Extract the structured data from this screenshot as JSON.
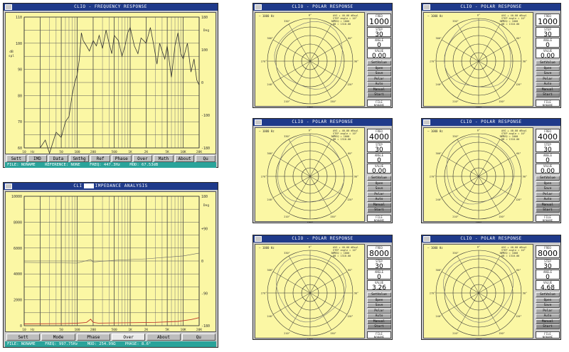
{
  "colors": {
    "title_bg": "#1f3a8a",
    "plot_bg": "#fbf7a4",
    "status_bg": "#2aa39a",
    "trace": "#333333",
    "impedance_trace": "#c0392b"
  },
  "freq_window": {
    "title": "CLIO - FREQUENCY RESPONSE",
    "y_left_unit": "dB\nspl",
    "y_right_unit": "Deg",
    "y_left_ticks": [
      "110",
      "100",
      "90",
      "80",
      "70",
      "60"
    ],
    "y_right_ticks": [
      "180",
      "100",
      "0",
      "-100",
      "-180"
    ],
    "x_ticks": [
      "10",
      "Hz",
      "50",
      "100",
      "200",
      "500",
      "1K",
      "2K",
      "5K",
      "10K",
      "20K"
    ],
    "buttons": [
      "Sett",
      "IMD",
      "Data",
      "Smthg",
      "Ref",
      "Phase",
      "Over",
      "Math",
      "About",
      "Qu"
    ],
    "status": {
      "file": "FILE: NONAME",
      "reference": "REFERENCE: NONE",
      "freq": "FREQ: 447.3Hz",
      "mod": "MOD: 67.53dB"
    }
  },
  "imp_window": {
    "title_prefix": "CLI",
    "title_suffix": "IMPEDANCE ANALYSIS",
    "y_left_ticks": [
      "10000",
      "8000",
      "6000",
      "4000",
      "2000",
      "0"
    ],
    "y_right_unit": "Deg",
    "y_right_ticks": [
      "180",
      "+90",
      "0",
      "-90",
      "-180"
    ],
    "x_ticks": [
      "10",
      "Hz",
      "50",
      "100",
      "200",
      "500",
      "1K",
      "2K",
      "5K",
      "10K",
      "20K"
    ],
    "buttons": [
      "Sett",
      "Mode",
      "Phase",
      "Over",
      "About",
      "Qu"
    ],
    "active_button": "Over",
    "status": {
      "file": "FILE: NONAME",
      "freq": "FREQ: 997.75Hz",
      "mod": "MOD: 254.99Ω",
      "phase": "PHASE: 8.6°"
    }
  },
  "polar_common": {
    "title": "CLIO - POLAR RESPONSE",
    "legend": "1000 Hz",
    "info": "AVG + 40.00 dBspl\nSTEP angle = 10°\nFREQ = 1000\nDB = 1310.00",
    "caption_freq": "FREQ",
    "caption_step": "STEP",
    "caption_angle": "ANGLE",
    "caption_value": "VALUE",
    "buttons": [
      "SetValue",
      "Open",
      "Save",
      "Polar",
      "Auto",
      "Manual",
      "Start"
    ],
    "file_caption": "FILE",
    "file_value": "NONAME",
    "angle_labels": [
      "0°",
      "30°",
      "60°",
      "90°",
      "120°",
      "150°",
      "180°",
      "210°",
      "240°",
      "270°",
      "300°",
      "330°"
    ]
  },
  "polars": [
    {
      "freq": "1000",
      "step": "30",
      "angle": "0",
      "value": "0.00"
    },
    {
      "freq": "1000",
      "step": "30",
      "angle": "0",
      "value": "0.00"
    },
    {
      "freq": "4000",
      "step": "30",
      "angle": "0",
      "value": "0.00"
    },
    {
      "freq": "4000",
      "step": "30",
      "angle": "0",
      "value": "0.00"
    },
    {
      "freq": "8000",
      "step": "30",
      "angle": "0",
      "value": "3.26"
    },
    {
      "freq": "8000",
      "step": "30",
      "angle": "0",
      "value": "4.68"
    }
  ]
}
